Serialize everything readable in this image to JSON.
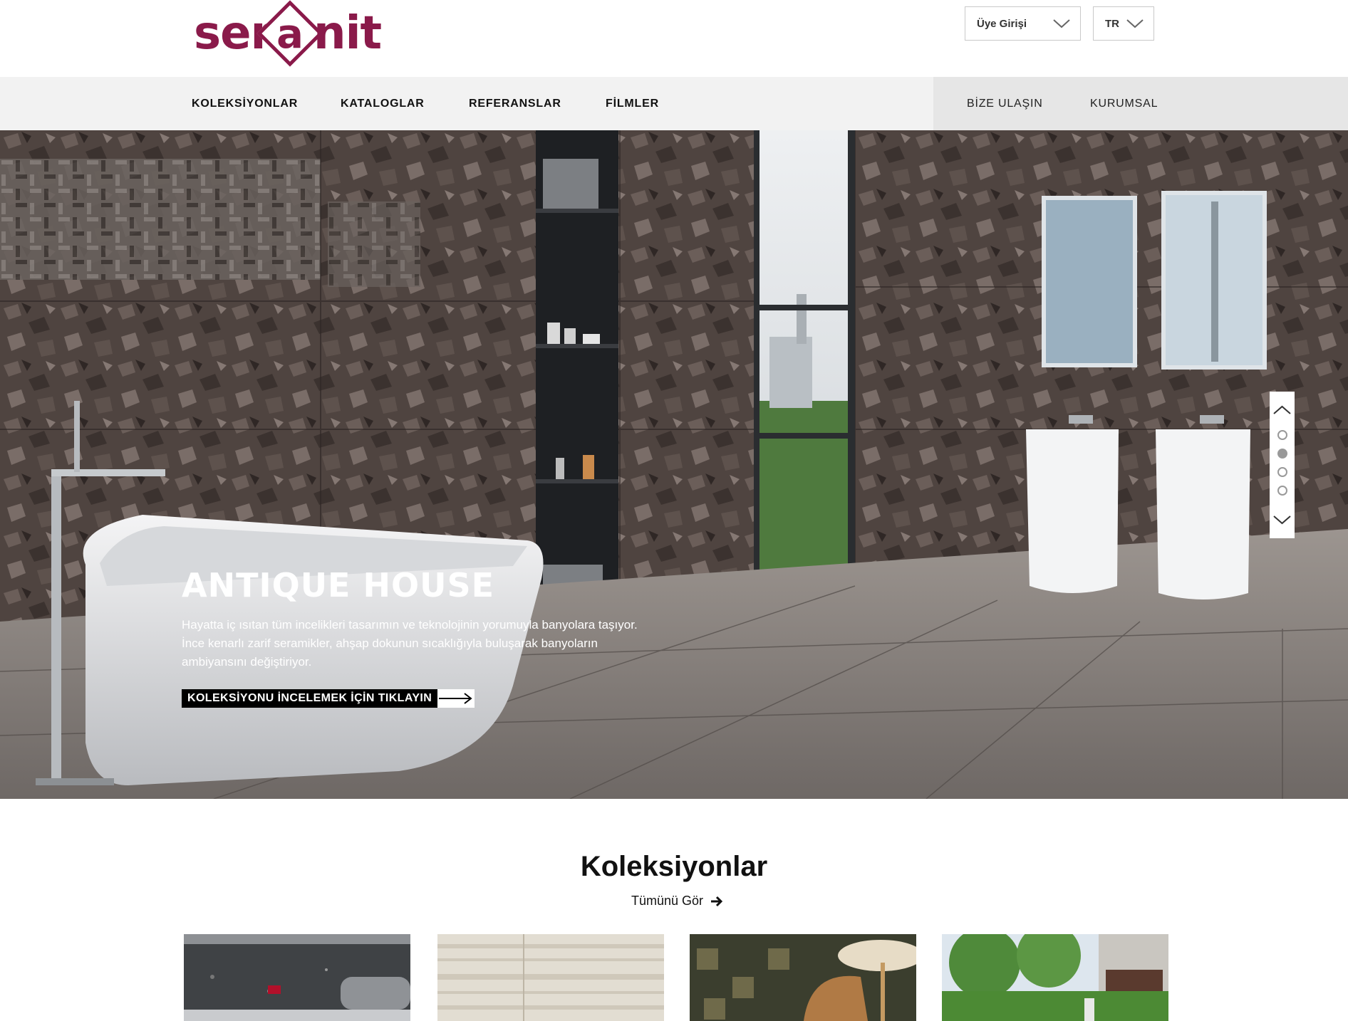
{
  "brand": {
    "logo_text_left": "ser",
    "logo_letter": "a",
    "logo_text_right": "nit",
    "color": "#8a1a4a"
  },
  "header": {
    "member_login": "Üye Girişi",
    "language": "TR"
  },
  "nav": {
    "left": [
      "KOLEKSİYONLAR",
      "KATALOGLAR",
      "REFERANSLAR",
      "FİLMLER"
    ],
    "right": [
      "BİZE ULAŞIN",
      "KURUMSAL"
    ]
  },
  "hero": {
    "title": "ANTIQUE HOUSE",
    "description": "Hayatta iç ısıtan tüm incelikleri tasarımın ve teknolojinin yorumuyla banyolara taşıyor. İnce kenarlı zarif seramikler, ahşap dokunun sıcaklığıyla buluşarak banyoların ambiyansını değiştiriyor.",
    "cta_label": "KOLEKSİYONU İNCELEMEK İÇİN TIKLAYIN",
    "slides": {
      "count": 4,
      "active": 2
    }
  },
  "collections": {
    "title": "Koleksiyonlar",
    "see_all": "Tümünü Gör",
    "thumbnails": [
      "grey-gravel-floor",
      "beige-stripe-tile",
      "patterned-floor-chair",
      "garden-house"
    ]
  }
}
